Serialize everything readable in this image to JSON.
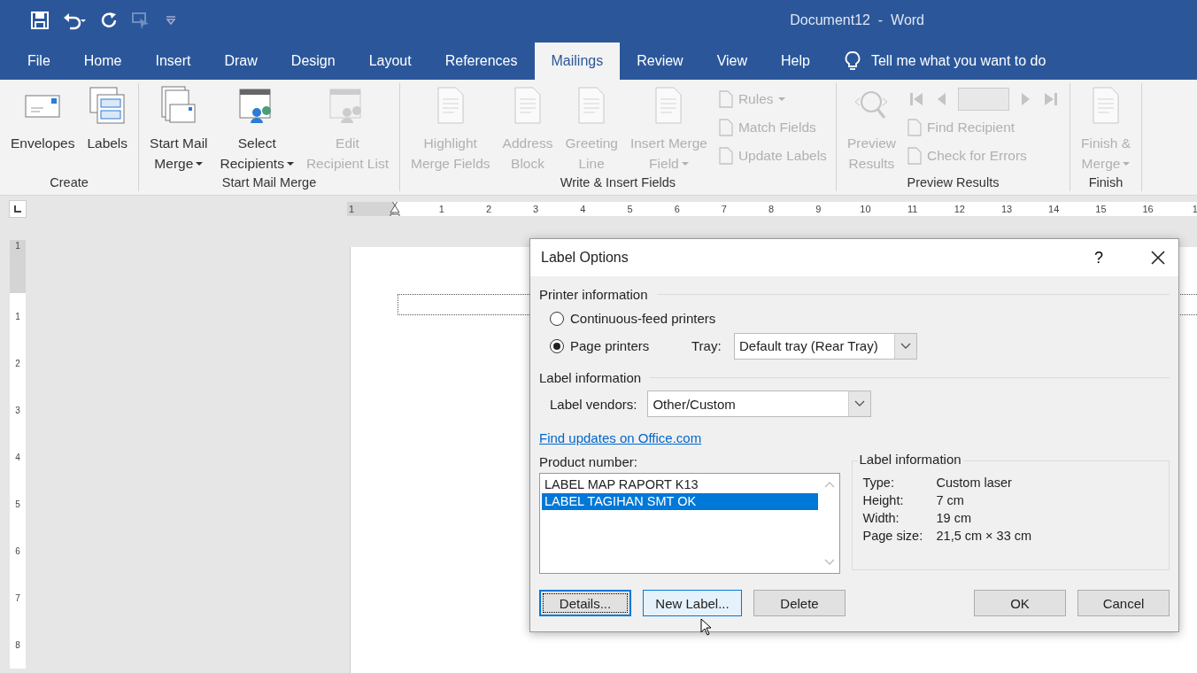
{
  "window": {
    "title": "Document12  -  Word"
  },
  "tabs": [
    {
      "label": "File",
      "selected": false
    },
    {
      "label": "Home",
      "selected": false
    },
    {
      "label": "Insert",
      "selected": false
    },
    {
      "label": "Draw",
      "selected": false
    },
    {
      "label": "Design",
      "selected": false
    },
    {
      "label": "Layout",
      "selected": false
    },
    {
      "label": "References",
      "selected": false
    },
    {
      "label": "Mailings",
      "selected": true
    },
    {
      "label": "Review",
      "selected": false
    },
    {
      "label": "View",
      "selected": false
    },
    {
      "label": "Help",
      "selected": false
    }
  ],
  "tell_me": "Tell me what you want to do",
  "ribbon": [
    {
      "label": "Create",
      "items": [
        {
          "kind": "large",
          "lines": [
            "Envelopes"
          ],
          "dropdown": false,
          "disabled": false
        },
        {
          "kind": "large",
          "lines": [
            "Labels"
          ],
          "dropdown": false,
          "disabled": false
        }
      ]
    },
    {
      "label": "Start Mail Merge",
      "items": [
        {
          "kind": "large",
          "lines": [
            "Start Mail",
            "Merge"
          ],
          "dropdown": true,
          "disabled": false
        },
        {
          "kind": "large",
          "lines": [
            "Select",
            "Recipients"
          ],
          "dropdown": true,
          "disabled": false
        },
        {
          "kind": "large",
          "lines": [
            "Edit",
            "Recipient List"
          ],
          "dropdown": false,
          "disabled": true
        }
      ]
    },
    {
      "label": "Write & Insert Fields",
      "items": [
        {
          "kind": "large",
          "lines": [
            "Highlight",
            "Merge Fields"
          ],
          "dropdown": false,
          "disabled": true
        },
        {
          "kind": "large",
          "lines": [
            "Address",
            "Block"
          ],
          "dropdown": false,
          "disabled": true
        },
        {
          "kind": "large",
          "lines": [
            "Greeting",
            "Line"
          ],
          "dropdown": false,
          "disabled": true
        },
        {
          "kind": "large",
          "lines": [
            "Insert Merge",
            "Field"
          ],
          "dropdown": true,
          "disabled": true
        },
        {
          "kind": "stack",
          "items": [
            {
              "label": "Rules",
              "dropdown": true,
              "disabled": true
            },
            {
              "label": "Match Fields",
              "dropdown": false,
              "disabled": true
            },
            {
              "label": "Update Labels",
              "dropdown": false,
              "disabled": true
            }
          ]
        }
      ]
    },
    {
      "label": "Preview Results",
      "items": [
        {
          "kind": "large",
          "lines": [
            "Preview",
            "Results"
          ],
          "dropdown": false,
          "disabled": true
        },
        {
          "kind": "nav",
          "items": [
            {
              "label": "Find Recipient",
              "disabled": true
            },
            {
              "label": "Check for Errors",
              "disabled": true
            }
          ]
        }
      ]
    },
    {
      "label": "Finish",
      "items": [
        {
          "kind": "large",
          "lines": [
            "Finish &",
            "Merge"
          ],
          "dropdown": true,
          "disabled": true
        }
      ]
    }
  ],
  "horizontal_ruler": [
    "1",
    "1",
    "2",
    "3",
    "4",
    "5",
    "6",
    "7",
    "8",
    "9",
    "10",
    "11",
    "12",
    "13",
    "14",
    "15",
    "16",
    "1"
  ],
  "vertical_ruler": [
    "1",
    "1",
    "2",
    "3",
    "4",
    "5",
    "6",
    "7",
    "8"
  ],
  "dialog": {
    "title": "Label Options",
    "help": "?",
    "printer_section": "Printer information",
    "printer_options": [
      {
        "label": "Continuous-feed printers",
        "selected": false
      },
      {
        "label": "Page printers",
        "selected": true
      }
    ],
    "tray": {
      "label": "Tray:",
      "value": "Default tray (Rear Tray)"
    },
    "label_section": "Label information",
    "vendors": {
      "label": "Label vendors:",
      "value": "Other/Custom"
    },
    "link": "Find updates on Office.com",
    "product_label": "Product number:",
    "products": [
      {
        "name": "LABEL MAP RAPORT K13",
        "selected": false
      },
      {
        "name": "LABEL TAGIHAN SMT OK",
        "selected": true
      }
    ],
    "info": {
      "title": "Label information",
      "rows": [
        {
          "key": "Type:",
          "value": "Custom laser"
        },
        {
          "key": "Height:",
          "value": "7 cm"
        },
        {
          "key": "Width:",
          "value": "19 cm"
        },
        {
          "key": "Page size:",
          "value": "21,5 cm × 33 cm"
        }
      ]
    },
    "buttons": [
      {
        "label": "Details...",
        "focused": true,
        "hovered": false
      },
      {
        "label": "New Label...",
        "focused": false,
        "hovered": true
      },
      {
        "label": "Delete",
        "focused": false,
        "hovered": false
      },
      {
        "label": "OK",
        "focused": false,
        "hovered": false
      },
      {
        "label": "Cancel",
        "focused": false,
        "hovered": false
      }
    ]
  }
}
